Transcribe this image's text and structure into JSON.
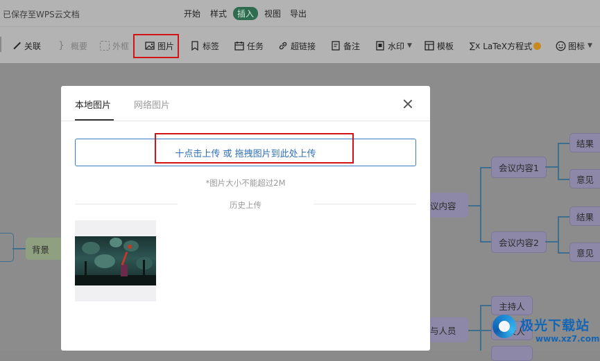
{
  "header": {
    "save_status": "已保存至WPS云文档",
    "menus": [
      {
        "label": "开始"
      },
      {
        "label": "样式"
      },
      {
        "label": "插入",
        "active": true
      },
      {
        "label": "视图"
      },
      {
        "label": "导出"
      }
    ]
  },
  "toolbar": {
    "items": [
      {
        "label": "关联",
        "icon": "link-line-icon"
      },
      {
        "label": "概要",
        "icon": "summary-brace-icon",
        "disabled": true
      },
      {
        "label": "外框",
        "icon": "frame-icon",
        "disabled": true
      },
      {
        "label": "图片",
        "icon": "image-icon",
        "highlighted": true
      },
      {
        "label": "标签",
        "icon": "tag-icon"
      },
      {
        "label": "任务",
        "icon": "calendar-icon"
      },
      {
        "label": "超链接",
        "icon": "hyperlink-icon"
      },
      {
        "label": "备注",
        "icon": "note-icon"
      },
      {
        "label": "水印",
        "icon": "watermark-icon",
        "has_dropdown": true
      },
      {
        "label": "模板",
        "icon": "template-icon"
      },
      {
        "label": "LaTeX方程式",
        "icon": "latex-icon",
        "badge_icon": "vip-coin-icon"
      },
      {
        "label": "图标",
        "icon": "smiley-icon",
        "has_dropdown": true
      }
    ],
    "highlight_color": "#d31313"
  },
  "mindmap": {
    "left_node": "背景",
    "center_nodes": [
      "议内容",
      "与人员"
    ],
    "content_children": [
      "会议内容1",
      "会议内容2"
    ],
    "leaves": [
      "结果",
      "意见",
      "结果",
      "意见"
    ],
    "people_children": [
      "主持人",
      "记录人"
    ]
  },
  "dialog": {
    "tabs": [
      {
        "label": "本地图片",
        "active": true
      },
      {
        "label": "网络图片",
        "active": false
      }
    ],
    "upload_text": "十点击上传 或 拖拽图片到此处上传",
    "size_hint": "*图片大小不能超过2M",
    "history_label": "历史上传",
    "accent_color": "#3a7bc4"
  },
  "watermark": {
    "title": "极光下载站",
    "url": "www.xz7.com"
  }
}
